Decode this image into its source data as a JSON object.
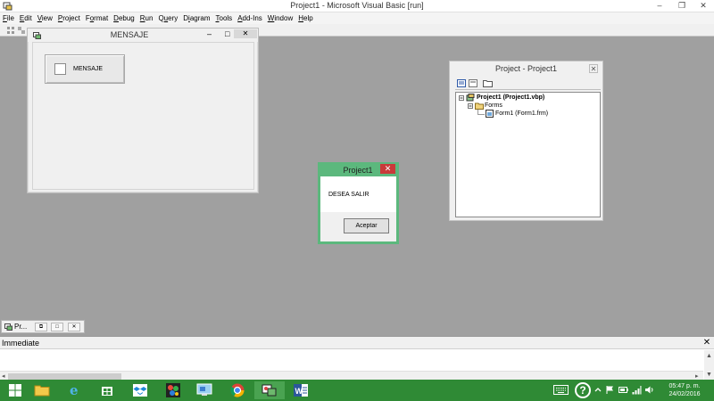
{
  "app": {
    "title": "Project1 - Microsoft Visual Basic [run]",
    "minimize": "–",
    "restore": "❐",
    "close": "✕"
  },
  "menubar": {
    "items": [
      {
        "pre": "",
        "u": "F",
        "post": "ile"
      },
      {
        "pre": "",
        "u": "E",
        "post": "dit"
      },
      {
        "pre": "",
        "u": "V",
        "post": "iew"
      },
      {
        "pre": "",
        "u": "P",
        "post": "roject"
      },
      {
        "pre": "F",
        "u": "o",
        "post": "rmat"
      },
      {
        "pre": "",
        "u": "D",
        "post": "ebug"
      },
      {
        "pre": "",
        "u": "R",
        "post": "un"
      },
      {
        "pre": "Q",
        "u": "u",
        "post": "ery"
      },
      {
        "pre": "D",
        "u": "i",
        "post": "agram"
      },
      {
        "pre": "",
        "u": "T",
        "post": "ools"
      },
      {
        "pre": "",
        "u": "A",
        "post": "dd-Ins"
      },
      {
        "pre": "",
        "u": "W",
        "post": "indow"
      },
      {
        "pre": "",
        "u": "H",
        "post": "elp"
      }
    ]
  },
  "form_window": {
    "title": "MENSAJE",
    "minimize": "–",
    "maximize": "□",
    "close": "✕",
    "button_label": "MENSAJE"
  },
  "project_explorer": {
    "title": "Project - Project1",
    "close": "✕",
    "tree": {
      "project": "Project1 (Project1.vbp)",
      "folder": "Forms",
      "form": "Form1 (Form1.frm)"
    }
  },
  "msgbox": {
    "title": "Project1",
    "close": "✕",
    "message": "DESEA SALIR",
    "ok_label": "Aceptar"
  },
  "minimized_window": {
    "label": "Pr..."
  },
  "immediate": {
    "title": "Immediate",
    "close": "✕"
  },
  "taskbar": {
    "time": "05:47 p. m.",
    "date": "24/02/2016",
    "help": "?"
  },
  "colors": {
    "taskbar": "#2f8a35",
    "msgbox_frame": "#5cb87d",
    "msgbox_close": "#c93a3a",
    "mdi_background": "#a0a0a0"
  }
}
